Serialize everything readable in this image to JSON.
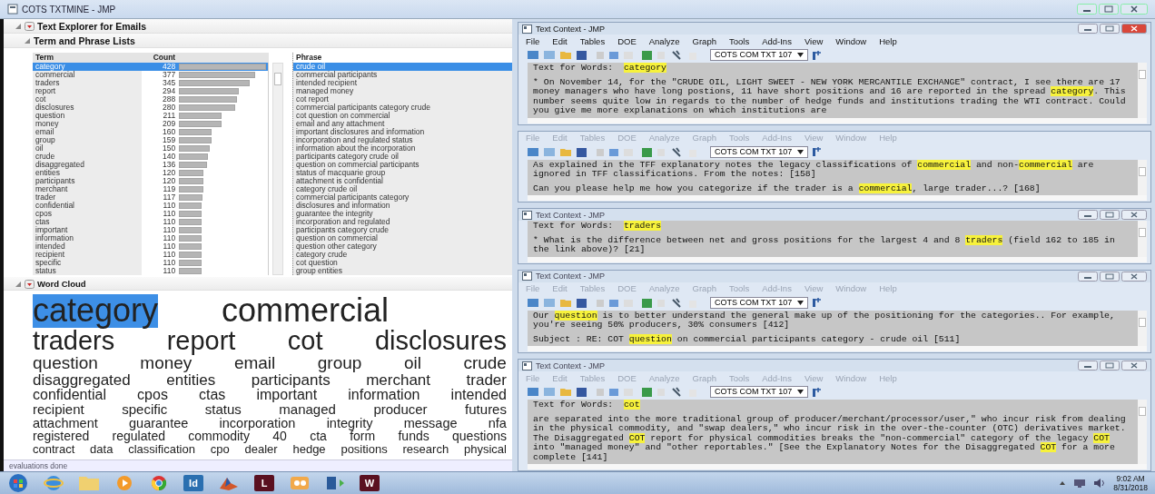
{
  "window": {
    "title": "COTS TXTMINE - JMP"
  },
  "explorer": {
    "title": "Text Explorer for Emails",
    "lists_title": "Term and Phrase Lists",
    "term_columns": [
      "Term",
      "Count"
    ],
    "phrase_column": "Phrase",
    "terms": [
      {
        "term": "category",
        "count": "428",
        "level": 1,
        "selected": true
      },
      {
        "term": "commercial",
        "count": "377",
        "level": 0.88,
        "selected": false
      },
      {
        "term": "traders",
        "count": "345",
        "level": 0.81,
        "selected": false
      },
      {
        "term": "report",
        "count": "294",
        "level": 0.69,
        "selected": false
      },
      {
        "term": "cot",
        "count": "288",
        "level": 0.67,
        "selected": false
      },
      {
        "term": "disclosures",
        "count": "280",
        "level": 0.65,
        "selected": false
      },
      {
        "term": "question",
        "count": "211",
        "level": 0.49,
        "selected": false
      },
      {
        "term": "money",
        "count": "209",
        "level": 0.49,
        "selected": false
      },
      {
        "term": "email",
        "count": "160",
        "level": 0.37,
        "selected": false
      },
      {
        "term": "group",
        "count": "159",
        "level": 0.37,
        "selected": false
      },
      {
        "term": "oil",
        "count": "150",
        "level": 0.35,
        "selected": false
      },
      {
        "term": "crude",
        "count": "140",
        "level": 0.33,
        "selected": false
      },
      {
        "term": "disaggregated",
        "count": "136",
        "level": 0.32,
        "selected": false
      },
      {
        "term": "entities",
        "count": "120",
        "level": 0.28,
        "selected": false
      },
      {
        "term": "participants",
        "count": "120",
        "level": 0.28,
        "selected": false
      },
      {
        "term": "merchant",
        "count": "119",
        "level": 0.28,
        "selected": false
      },
      {
        "term": "trader",
        "count": "117",
        "level": 0.27,
        "selected": false
      },
      {
        "term": "confidential",
        "count": "110",
        "level": 0.26,
        "selected": false
      },
      {
        "term": "cpos",
        "count": "110",
        "level": 0.26,
        "selected": false
      },
      {
        "term": "ctas",
        "count": "110",
        "level": 0.26,
        "selected": false
      },
      {
        "term": "important",
        "count": "110",
        "level": 0.26,
        "selected": false
      },
      {
        "term": "information",
        "count": "110",
        "level": 0.26,
        "selected": false
      },
      {
        "term": "intended",
        "count": "110",
        "level": 0.26,
        "selected": false
      },
      {
        "term": "recipient",
        "count": "110",
        "level": 0.26,
        "selected": false
      },
      {
        "term": "specific",
        "count": "110",
        "level": 0.26,
        "selected": false
      },
      {
        "term": "status",
        "count": "110",
        "level": 0.26,
        "selected": false
      }
    ],
    "phrases": [
      {
        "text": "crude oil",
        "selected": true
      },
      {
        "text": "commercial participants",
        "selected": false
      },
      {
        "text": "intended recipient",
        "selected": false
      },
      {
        "text": "managed money",
        "selected": false
      },
      {
        "text": "cot report",
        "selected": false
      },
      {
        "text": "commercial participants category crude",
        "selected": false
      },
      {
        "text": "cot question on commercial",
        "selected": false
      },
      {
        "text": "email and any attachment",
        "selected": false
      },
      {
        "text": "important disclosures and information",
        "selected": false
      },
      {
        "text": "incorporation and regulated status",
        "selected": false
      },
      {
        "text": "information about the incorporation",
        "selected": false
      },
      {
        "text": "participants category crude oil",
        "selected": false
      },
      {
        "text": "question on commercial participants",
        "selected": false
      },
      {
        "text": "status of macquarie group",
        "selected": false
      },
      {
        "text": "attachment is confidential",
        "selected": false
      },
      {
        "text": "category crude oil",
        "selected": false
      },
      {
        "text": "commercial participants category",
        "selected": false
      },
      {
        "text": "disclosures and information",
        "selected": false
      },
      {
        "text": "guarantee the integrity",
        "selected": false
      },
      {
        "text": "incorporation and regulated",
        "selected": false
      },
      {
        "text": "participants category crude",
        "selected": false
      },
      {
        "text": "question on commercial",
        "selected": false
      },
      {
        "text": "question other category",
        "selected": false
      },
      {
        "text": "category crude",
        "selected": false
      },
      {
        "text": "cot question",
        "selected": false
      },
      {
        "text": "group entities",
        "selected": false
      }
    ],
    "word_cloud": {
      "title": "Word Cloud",
      "lines": [
        [
          {
            "word": "category",
            "selected": true
          },
          {
            "word": "commercial",
            "selected": false
          }
        ],
        [
          {
            "word": "traders",
            "selected": false
          },
          {
            "word": "report",
            "selected": false
          },
          {
            "word": "cot",
            "selected": false
          },
          {
            "word": "disclosures",
            "selected": false
          }
        ],
        [
          {
            "word": "question",
            "selected": false
          },
          {
            "word": "money",
            "selected": false
          },
          {
            "word": "email",
            "selected": false
          },
          {
            "word": "group",
            "selected": false
          },
          {
            "word": "oil",
            "selected": false
          },
          {
            "word": "crude",
            "selected": false
          }
        ],
        [
          {
            "word": "disaggregated",
            "selected": false
          },
          {
            "word": "entities",
            "selected": false
          },
          {
            "word": "participants",
            "selected": false
          },
          {
            "word": "merchant",
            "selected": false
          },
          {
            "word": "trader",
            "selected": false
          }
        ],
        [
          {
            "word": "confidential",
            "selected": false
          },
          {
            "word": "cpos",
            "selected": false
          },
          {
            "word": "ctas",
            "selected": false
          },
          {
            "word": "important",
            "selected": false
          },
          {
            "word": "information",
            "selected": false
          },
          {
            "word": "intended",
            "selected": false
          }
        ],
        [
          {
            "word": "recipient",
            "selected": false
          },
          {
            "word": "specific",
            "selected": false
          },
          {
            "word": "status",
            "selected": false
          },
          {
            "word": "managed",
            "selected": false
          },
          {
            "word": "producer",
            "selected": false
          },
          {
            "word": "futures",
            "selected": false
          }
        ],
        [
          {
            "word": "attachment",
            "selected": false
          },
          {
            "word": "guarantee",
            "selected": false
          },
          {
            "word": "incorporation",
            "selected": false
          },
          {
            "word": "integrity",
            "selected": false
          },
          {
            "word": "message",
            "selected": false
          },
          {
            "word": "nfa",
            "selected": false
          }
        ],
        [
          {
            "word": "registered",
            "selected": false
          },
          {
            "word": "regulated",
            "selected": false
          },
          {
            "word": "commodity",
            "selected": false
          },
          {
            "word": "40",
            "selected": false
          },
          {
            "word": "cta",
            "selected": false
          },
          {
            "word": "form",
            "selected": false
          },
          {
            "word": "funds",
            "selected": false
          },
          {
            "word": "questions",
            "selected": false
          }
        ],
        [
          {
            "word": "contract",
            "selected": false
          },
          {
            "word": "data",
            "selected": false
          },
          {
            "word": "classification",
            "selected": false
          },
          {
            "word": "cpo",
            "selected": false
          },
          {
            "word": "dealer",
            "selected": false
          },
          {
            "word": "hedge",
            "selected": false
          },
          {
            "word": "positions",
            "selected": false
          },
          {
            "word": "research",
            "selected": false
          },
          {
            "word": "physical",
            "selected": false
          }
        ]
      ]
    },
    "status": "evaluations done"
  },
  "context_windows": [
    {
      "title": "Text Context - JMP",
      "active": true,
      "menu": [
        "File",
        "Edit",
        "Tables",
        "DOE",
        "Analyze",
        "Graph",
        "Tools",
        "Add-Ins",
        "View",
        "Window",
        "Help"
      ],
      "dropdown": "COTS COM TXT 107",
      "paragraphs": [
        [
          {
            "text": "Text for Words:  ",
            "highlighted": false
          },
          {
            "text": "category",
            "highlighted": true
          }
        ],
        [
          {
            "text": "* On November 14, for the \"CRUDE OIL, LIGHT SWEET - NEW YORK MERCANTILE EXCHANGE\" contract, I see there are 17 money managers who have long postions, 11 have short positions and 16 are reported in the spread ",
            "highlighted": false
          },
          {
            "text": "category",
            "highlighted": true
          },
          {
            "text": ". This number seems quite low in regards to the number of hedge funds and institutions trading the WTI contract. Could you give me more explanations on which institutions are",
            "highlighted": false
          }
        ]
      ]
    },
    {
      "active": false,
      "menu": [
        "File",
        "Edit",
        "Tables",
        "DOE",
        "Analyze",
        "Graph",
        "Tools",
        "Add-Ins",
        "View",
        "Window",
        "Help"
      ],
      "dropdown": "COTS COM TXT 107",
      "paragraphs": [
        [
          {
            "text": "As explained in the TFF explanatory notes the legacy classifications of ",
            "highlighted": false
          },
          {
            "text": "commercial",
            "highlighted": true
          },
          {
            "text": " and non-",
            "highlighted": false
          },
          {
            "text": "commercial",
            "highlighted": true
          },
          {
            "text": " are ignored in TFF classifications. From the notes: [158]",
            "highlighted": false
          }
        ],
        [
          {
            "text": "Can you please help me how you categorize if the trader is a ",
            "highlighted": false
          },
          {
            "text": "commercial",
            "highlighted": true
          },
          {
            "text": ", large trader...? [168]",
            "highlighted": false
          }
        ]
      ]
    },
    {
      "title": "Text Context - JMP",
      "active": false,
      "paragraphs": [
        [
          {
            "text": "Text for Words:  ",
            "highlighted": false
          },
          {
            "text": "traders",
            "highlighted": true
          }
        ],
        [
          {
            "text": "* What is the difference between net and gross positions for the largest 4 and 8 ",
            "highlighted": false
          },
          {
            "text": "traders",
            "highlighted": true
          },
          {
            "text": " (field 162 to 185 in the link above)? [21]",
            "highlighted": false
          }
        ]
      ]
    },
    {
      "title": "Text Context - JMP",
      "active": false,
      "menu": [
        "File",
        "Edit",
        "Tables",
        "DOE",
        "Analyze",
        "Graph",
        "Tools",
        "Add-Ins",
        "View",
        "Window",
        "Help"
      ],
      "dropdown": "COTS COM TXT 107",
      "paragraphs": [
        [
          {
            "text": "Our ",
            "highlighted": false
          },
          {
            "text": "question",
            "highlighted": true
          },
          {
            "text": " is to better understand the general make up of the positioning for the categories.. For example, you're seeing 50% producers, 30% consumers [412]",
            "highlighted": false
          }
        ],
        [
          {
            "text": "Subject : RE: COT ",
            "highlighted": false
          },
          {
            "text": "question",
            "highlighted": true
          },
          {
            "text": " on commercial participants category - crude oil [511]",
            "highlighted": false
          }
        ]
      ]
    },
    {
      "title": "Text Context - JMP",
      "active": false,
      "menu": [
        "File",
        "Edit",
        "Tables",
        "DOE",
        "Analyze",
        "Graph",
        "Tools",
        "Add-Ins",
        "View",
        "Window",
        "Help"
      ],
      "dropdown": "COTS COM TXT 107",
      "paragraphs": [
        [
          {
            "text": "Text for Words:  ",
            "highlighted": false
          },
          {
            "text": "cot",
            "highlighted": true
          }
        ],
        [
          {
            "text": "are separated into the more traditional group of producer/merchant/processor/user,\" who incur risk from dealing in the physical commodity, and \"swap dealers,\" who incur risk in the over-the-counter (OTC) derivatives market. The Disaggregated ",
            "highlighted": false
          },
          {
            "text": "COT",
            "highlighted": true
          },
          {
            "text": " report for physical commodities breaks the \"non-commercial\" category of the legacy ",
            "highlighted": false
          },
          {
            "text": "COT",
            "highlighted": true
          },
          {
            "text": " into \"managed money\" and \"other reportables.\" [See the Explanatory Notes for the Disaggregated ",
            "highlighted": false
          },
          {
            "text": "COT",
            "highlighted": true
          },
          {
            "text": " for a more complete [141]",
            "highlighted": false
          }
        ]
      ]
    }
  ],
  "taskbar": {
    "apps": [
      {
        "kind": "globe"
      },
      {
        "kind": "folder"
      },
      {
        "kind": "play"
      },
      {
        "kind": "ring"
      },
      {
        "kind": "letter",
        "label": "Id"
      },
      {
        "kind": "peak"
      },
      {
        "kind": "letter",
        "label": "L"
      },
      {
        "kind": "tile"
      },
      {
        "kind": "arrow"
      },
      {
        "kind": "letter",
        "label": "W"
      }
    ],
    "time": "9:02 AM",
    "date": "8/31/2018"
  }
}
